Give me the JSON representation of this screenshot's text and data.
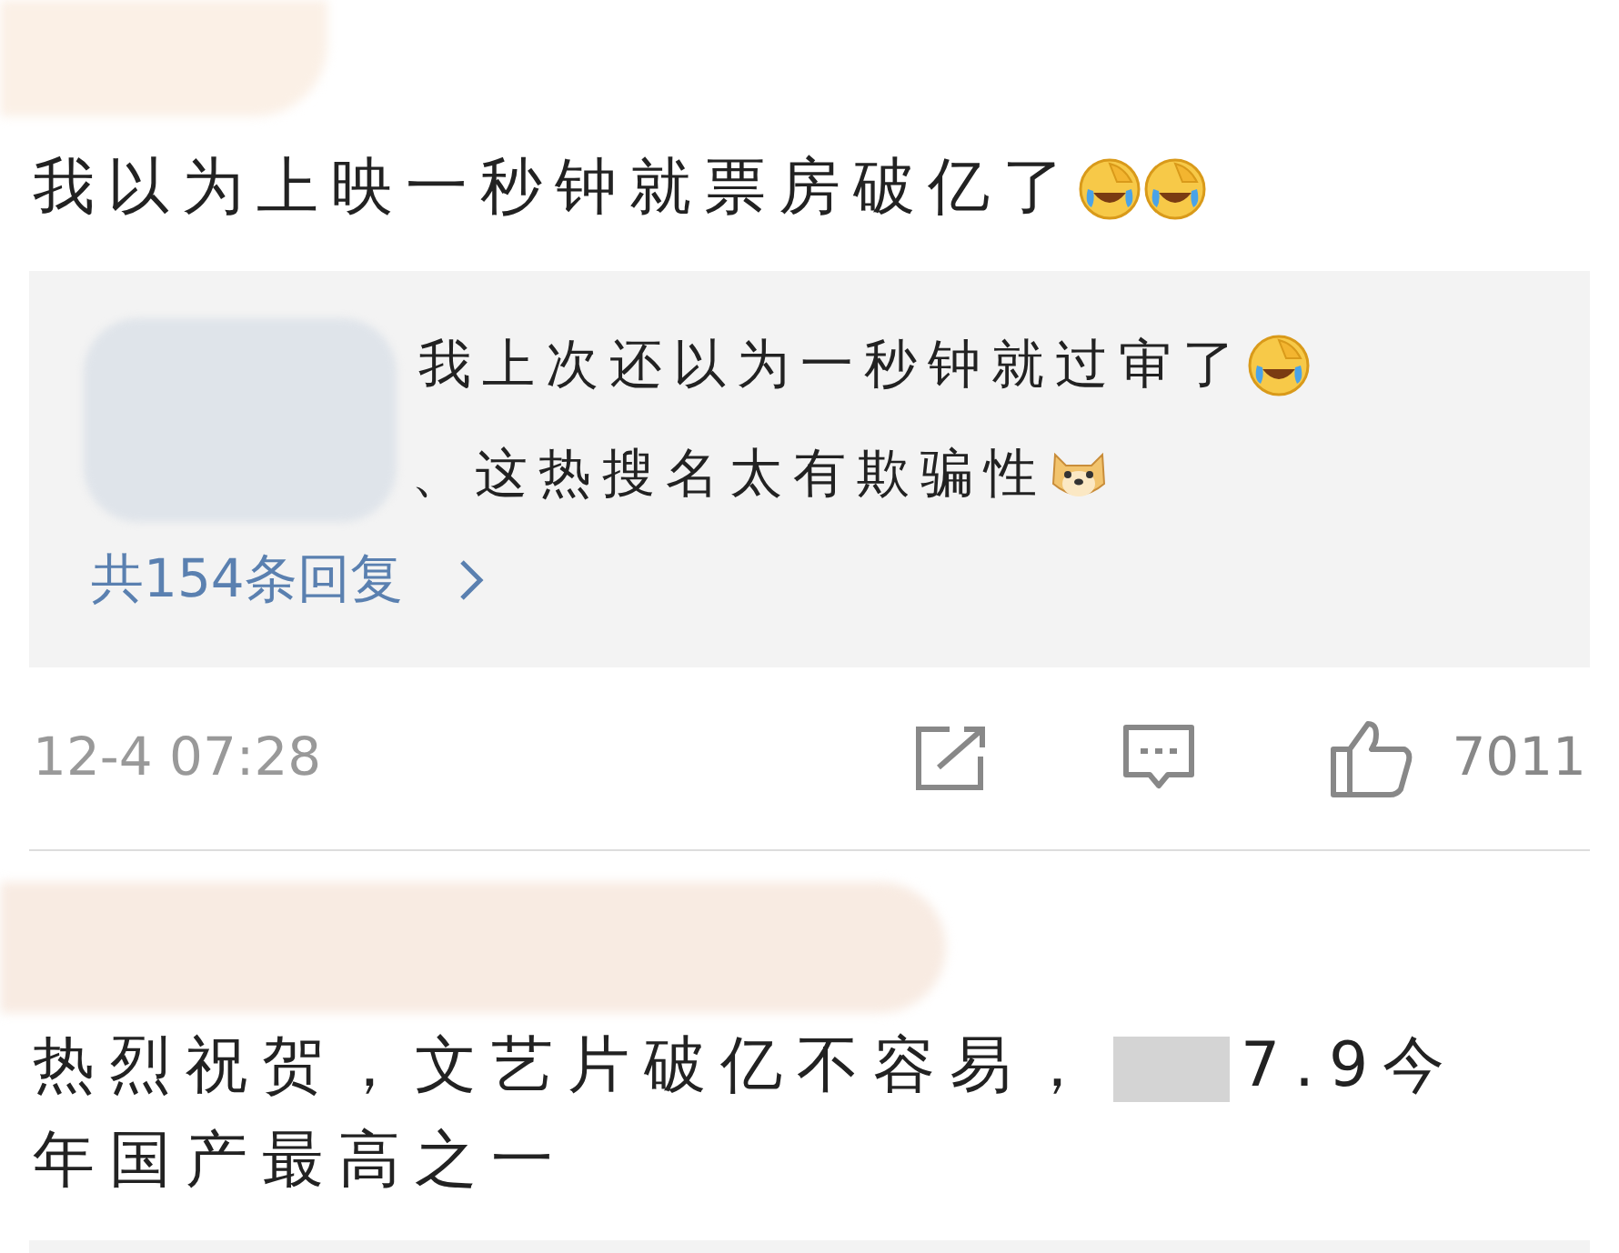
{
  "comments": [
    {
      "text": "我以为上映一秒钟就票房破亿了",
      "replies": [
        {
          "text": "我上次还以为一秒钟就过审了"
        },
        {
          "text": "、这热搜名太有欺骗性"
        }
      ],
      "reply_count": "共154条回复",
      "time": "12-4 07:28",
      "likes": "7011"
    },
    {
      "text_before": "热烈祝贺，文艺片破亿不容易，",
      "text_after": "7.9今年国产最高之一"
    }
  ]
}
